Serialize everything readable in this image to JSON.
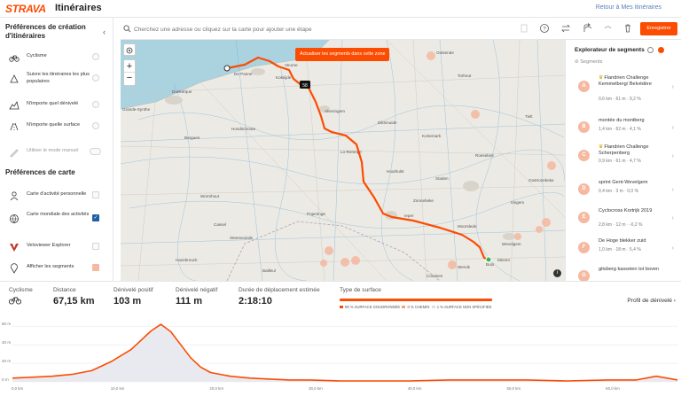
{
  "header": {
    "logo": "STRAVA",
    "title": "Itinéraires",
    "back_link": "Retour à Mes itinéraires"
  },
  "sidebar": {
    "creation_title": "Préférences de création d'itinéraires",
    "creation_options": [
      {
        "label": "Cyclisme",
        "icon": "bike-icon",
        "selected": true
      },
      {
        "label": "Suivre les itinéraires les plus populaires",
        "icon": "popular-route-icon",
        "selected": false
      },
      {
        "label": "N'importe quel dénivelé",
        "icon": "elevation-icon",
        "selected": false
      },
      {
        "label": "N'importe quelle surface",
        "icon": "surface-icon",
        "selected": false
      },
      {
        "label": "Utiliser le mode manuel",
        "icon": "manual-mode-icon",
        "selected": false
      }
    ],
    "map_title": "Préférences de carte",
    "map_options": [
      {
        "label": "Carte d'activité personnelle",
        "icon": "personal-heatmap-icon",
        "checked": false
      },
      {
        "label": "Carte mondiale des activités",
        "icon": "global-heatmap-icon",
        "checked": true,
        "color": "#1f5fa6"
      },
      {
        "label": "Veloviewer Explorer",
        "icon": "veloviewer-icon",
        "checked": false
      },
      {
        "label": "Afficher les segments",
        "icon": "segments-pin-icon",
        "checked": true,
        "color": "#f5b8a0"
      }
    ]
  },
  "toolbar": {
    "search_placeholder": "Cherchez une adresse ou cliquez sur la carte pour ajouter une étape",
    "save_label": "Enregistrer"
  },
  "map": {
    "update_segments_button": "Actualiser les segments dans cette zone",
    "route_color": "#fc4c02",
    "km_marker": "58",
    "place_labels": [
      "Dunkerque",
      "Grande-Synthe",
      "Bergues",
      "Hondschoote",
      "Wormhout",
      "Cassel",
      "Steenvoorde",
      "Hazebrouck",
      "Poperinge",
      "Ieper",
      "Zonnebeke",
      "Roeselare",
      "Torhout",
      "Tielt",
      "Oostende",
      "Veurne",
      "De Panne",
      "Alveringem",
      "Diksmuide",
      "Kortemark",
      "Menen",
      "Wevelgem",
      "Comines",
      "Wervik",
      "Lo-Reninge",
      "Houthulst",
      "Staden",
      "Moorslede",
      "Oostrozebeke",
      "Izegem",
      "Bailleul",
      "Bulo",
      "Koksijde",
      "Nieuwpoort",
      "Gistel"
    ]
  },
  "explorer": {
    "title": "Explorateur de segments",
    "tab": "Segments",
    "segments": [
      {
        "badge": "A",
        "name": "Flandrien Challenge Kemmelberg/ Belvédère",
        "stats": "0,6 km · 61 m · 9,2 %",
        "kom": true
      },
      {
        "badge": "B",
        "name": "montée du montberg",
        "stats": "1,4 km · 62 m · 4,1 %",
        "kom": false
      },
      {
        "badge": "C",
        "name": "Flandrien Challenge Scherpenberg",
        "stats": "0,9 km · 61 m · 4,7 %",
        "kom": true
      },
      {
        "badge": "D",
        "name": "sprint Gent-Wevelgem",
        "stats": "0,4 km · 3 m · 0,0 %",
        "kom": false
      },
      {
        "badge": "E",
        "name": "Cyclocross Kortrijk 2019",
        "stats": "2,8 km · 12 m · -0,2 %",
        "kom": false
      },
      {
        "badge": "F",
        "name": "De Hoge blekker zuid",
        "stats": "1,0 km · 18 m · 5,4 %",
        "kom": false
      },
      {
        "badge": "G",
        "name": "gitsberg kasseien tot boven",
        "stats": "",
        "kom": false
      }
    ]
  },
  "stats": {
    "activity_label": "Cyclisme",
    "distance_label": "Distance",
    "distance_value": "67,15 km",
    "gain_label": "Dénivelé positif",
    "gain_value": "103 m",
    "loss_label": "Dénivelé négatif",
    "loss_value": "111 m",
    "duration_label": "Durée de déplacement estimée",
    "duration_value": "2:18:10",
    "surface_label": "Type de surface",
    "surface_legend": [
      {
        "label": "99 % SURFACE GOUDRONNÉE",
        "color": "#fc4c02"
      },
      {
        "label": "0 % CHEMIN",
        "color": "#f7a27a"
      },
      {
        "label": "1 % SURFACE NON SPÉCIFIÉE",
        "color": "#e0e0e0"
      }
    ],
    "profile_link": "Profil de dénivelé"
  },
  "elevation": {
    "y_ticks": [
      "60 m",
      "40 m",
      "20 m",
      "0 m"
    ],
    "x_ticks": [
      "0,0 km",
      "10,0 km",
      "20,0 km",
      "30,0 km",
      "40,0 km",
      "50,0 km",
      "60,0 km"
    ],
    "line_color": "#fc4c02",
    "km": [
      0,
      2,
      4,
      6,
      8,
      10,
      12,
      14,
      15,
      16,
      17,
      18,
      19,
      20,
      22,
      24,
      26,
      28,
      30,
      33,
      36,
      40,
      44,
      48,
      52,
      56,
      60,
      63,
      65,
      67.15
    ],
    "m": [
      4,
      5,
      6,
      8,
      12,
      22,
      35,
      55,
      62,
      54,
      40,
      26,
      16,
      10,
      6,
      4,
      3,
      2,
      2,
      1,
      1,
      1,
      2,
      2,
      2,
      1,
      2,
      2,
      6,
      2
    ]
  }
}
